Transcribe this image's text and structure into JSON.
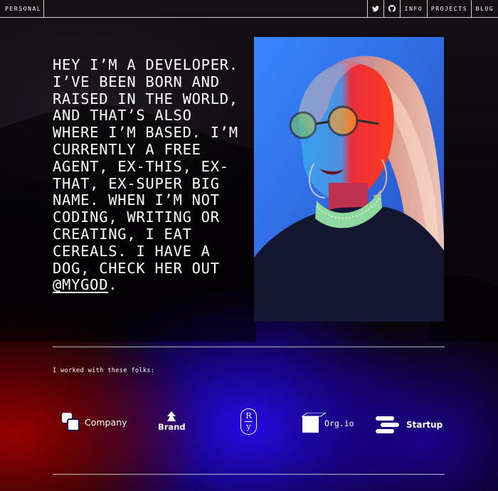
{
  "nav": {
    "brand": "PERSONAL",
    "icons": [
      "twitter-icon",
      "github-icon"
    ],
    "links": [
      "INFO",
      "PROJECTS",
      "BLOG"
    ]
  },
  "bio": {
    "text": "HEY I’M A DEVELOPER. I’VE BEEN BORN AND RAISED IN THE WORLD, AND THAT’S ALSO WHERE I’M BASED. I’M CURRENTLY A FREE AGENT, EX-THIS, EX-THAT, EX-SUPER BIG NAME. WHEN I’M NOT CODING, WRITING OR CREATING, I EAT CEREALS. I HAVE A DOG, CHECK HER OUT ",
    "link": "@MYGOD",
    "end": "."
  },
  "clients": {
    "heading": "I worked with these folks:",
    "logos": [
      {
        "name": "Company",
        "icon": "company-logo-icon"
      },
      {
        "name": "Brand",
        "icon": "brand-logo-icon"
      },
      {
        "name": "Ry",
        "letters": [
          "R",
          "y"
        ],
        "icon": "ry-logo-icon"
      },
      {
        "name": "Org.io",
        "icon": "org-logo-icon"
      },
      {
        "name": "Startup",
        "icon": "startup-logo-icon"
      }
    ]
  },
  "colors": {
    "red_glow": "#a00000",
    "blue_glow": "#2a0af0",
    "background": "#050208",
    "text": "#ffffff"
  }
}
